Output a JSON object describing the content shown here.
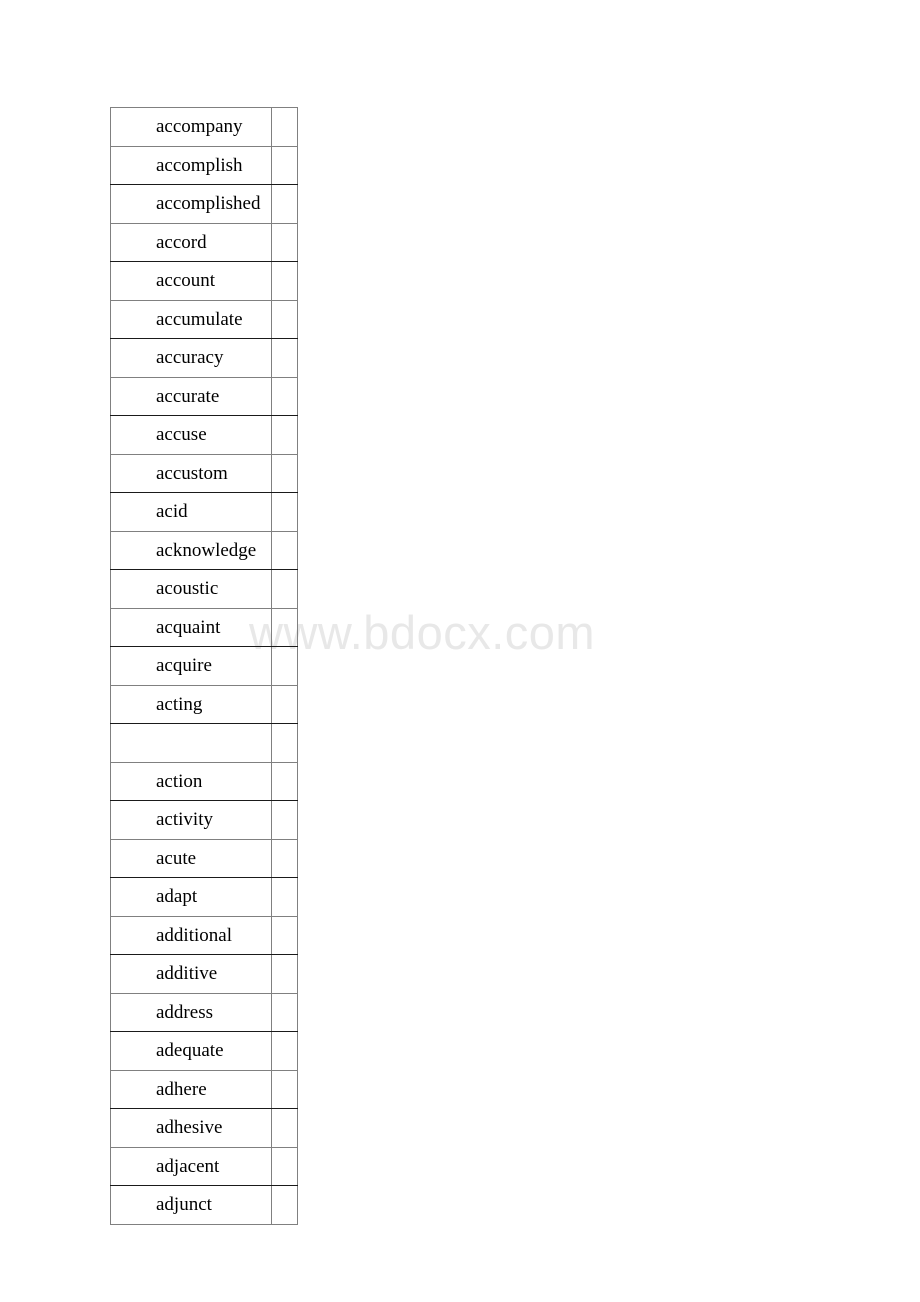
{
  "page": {
    "background_color": "#ffffff",
    "text_color": "#000000",
    "border_color": "#808080",
    "border_color_dark": "#1a1a1a"
  },
  "watermark": {
    "text": "www.bdocx.com",
    "color": "#e8e8e8"
  },
  "table": {
    "columns": [
      {
        "key": "word",
        "label": ""
      },
      {
        "key": "blank",
        "label": ""
      }
    ],
    "rows": [
      {
        "word": "accompany",
        "blank": ""
      },
      {
        "word": "accomplish",
        "blank": ""
      },
      {
        "word": "accomplished",
        "blank": ""
      },
      {
        "word": "accord",
        "blank": ""
      },
      {
        "word": "account",
        "blank": ""
      },
      {
        "word": "accumulate",
        "blank": ""
      },
      {
        "word": "accuracy",
        "blank": ""
      },
      {
        "word": "accurate",
        "blank": ""
      },
      {
        "word": "accuse",
        "blank": ""
      },
      {
        "word": "accustom",
        "blank": ""
      },
      {
        "word": "acid",
        "blank": ""
      },
      {
        "word": "acknowledge",
        "blank": ""
      },
      {
        "word": "acoustic",
        "blank": ""
      },
      {
        "word": "acquaint",
        "blank": ""
      },
      {
        "word": "acquire",
        "blank": ""
      },
      {
        "word": "acting",
        "blank": ""
      },
      {
        "word": "",
        "blank": ""
      },
      {
        "word": "action",
        "blank": ""
      },
      {
        "word": "activity",
        "blank": ""
      },
      {
        "word": "acute",
        "blank": ""
      },
      {
        "word": "adapt",
        "blank": ""
      },
      {
        "word": "additional",
        "blank": ""
      },
      {
        "word": "additive",
        "blank": ""
      },
      {
        "word": "address",
        "blank": ""
      },
      {
        "word": "adequate",
        "blank": ""
      },
      {
        "word": "adhere",
        "blank": ""
      },
      {
        "word": "adhesive",
        "blank": ""
      },
      {
        "word": "adjacent",
        "blank": ""
      },
      {
        "word": "adjunct",
        "blank": ""
      }
    ]
  }
}
